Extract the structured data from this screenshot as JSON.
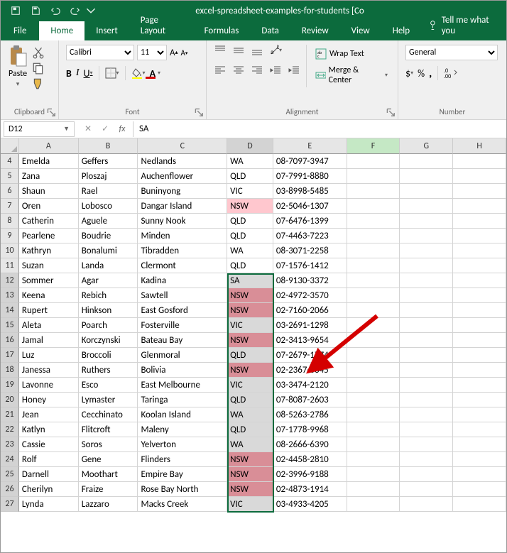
{
  "window": {
    "title": "excel-spreadsheet-examples-for-students  [Co"
  },
  "tabs": {
    "file": "File",
    "home": "Home",
    "insert": "Insert",
    "pagelayout": "Page Layout",
    "formulas": "Formulas",
    "data": "Data",
    "review": "Review",
    "view": "View",
    "help": "Help",
    "tell": "Tell me what you"
  },
  "ribbon": {
    "clipboard": {
      "paste": "Paste",
      "label": "Clipboard"
    },
    "font": {
      "name": "Calibri",
      "size": "11",
      "label": "Font"
    },
    "alignment": {
      "wrap": "Wrap Text",
      "merge": "Merge & Center",
      "label": "Alignment"
    },
    "number": {
      "format": "General",
      "label": "Number"
    }
  },
  "formula_bar": {
    "name": "D12",
    "value": "SA"
  },
  "columns": [
    "A",
    "B",
    "C",
    "D",
    "E",
    "F",
    "G",
    "H"
  ],
  "row_start": 4,
  "rows": [
    {
      "n": 4,
      "a": "Emelda",
      "b": "Geffers",
      "c": "Nedlands",
      "d": "WA",
      "e": "08-7097-3947",
      "cls": ""
    },
    {
      "n": 5,
      "a": "Zana",
      "b": "Ploszaj",
      "c": "Auchenflower",
      "d": "QLD",
      "e": "07-7991-8880",
      "cls": ""
    },
    {
      "n": 6,
      "a": "Shaun",
      "b": "Rael",
      "c": "Buninyong",
      "d": "VIC",
      "e": "03-8998-5485",
      "cls": ""
    },
    {
      "n": 7,
      "a": "Oren",
      "b": "Lobosco",
      "c": "Dangar Island",
      "d": "NSW",
      "e": "02-5046-1307",
      "cls": "d-row7"
    },
    {
      "n": 8,
      "a": "Catherin",
      "b": "Aguele",
      "c": "Sunny Nook",
      "d": "QLD",
      "e": "07-6476-1399",
      "cls": ""
    },
    {
      "n": 9,
      "a": "Pearlene",
      "b": "Boudrie",
      "c": "Minden",
      "d": "QLD",
      "e": "07-4463-7223",
      "cls": ""
    },
    {
      "n": 10,
      "a": "Kathryn",
      "b": "Bonalumi",
      "c": "Tibradden",
      "d": "WA",
      "e": "08-3071-2258",
      "cls": ""
    },
    {
      "n": 11,
      "a": "Suzan",
      "b": "Landa",
      "c": "Clermont",
      "d": "QLD",
      "e": "07-1576-1412",
      "cls": ""
    },
    {
      "n": 12,
      "a": "Sommer",
      "b": "Agar",
      "c": "Kadina",
      "d": "SA",
      "e": "08-9130-3372",
      "cls": "d-gray"
    },
    {
      "n": 13,
      "a": "Keena",
      "b": "Rebich",
      "c": "Sawtell",
      "d": "NSW",
      "e": "02-4972-3570",
      "cls": "d-darkpink"
    },
    {
      "n": 14,
      "a": "Rupert",
      "b": "Hinkson",
      "c": "East Gosford",
      "d": "NSW",
      "e": "02-7160-2066",
      "cls": "d-darkpink"
    },
    {
      "n": 15,
      "a": "Aleta",
      "b": "Poarch",
      "c": "Fosterville",
      "d": "VIC",
      "e": "03-2691-1298",
      "cls": "d-gray"
    },
    {
      "n": 16,
      "a": "Jamal",
      "b": "Korczynski",
      "c": "Bateau Bay",
      "d": "NSW",
      "e": "02-3413-9654",
      "cls": "d-darkpink"
    },
    {
      "n": 17,
      "a": "Luz",
      "b": "Broccoli",
      "c": "Glenmoral",
      "d": "QLD",
      "e": "07-2679-1774",
      "cls": "d-gray"
    },
    {
      "n": 18,
      "a": "Janessa",
      "b": "Ruthers",
      "c": "Bolivia",
      "d": "NSW",
      "e": "02-2367-6845",
      "cls": "d-darkpink"
    },
    {
      "n": 19,
      "a": "Lavonne",
      "b": "Esco",
      "c": "East Melbourne",
      "d": "VIC",
      "e": "03-3474-2120",
      "cls": "d-gray"
    },
    {
      "n": 20,
      "a": "Honey",
      "b": "Lymaster",
      "c": "Taringa",
      "d": "QLD",
      "e": "07-8087-2603",
      "cls": "d-gray"
    },
    {
      "n": 21,
      "a": "Jean",
      "b": "Cecchinato",
      "c": "Koolan Island",
      "d": "WA",
      "e": "08-5263-2786",
      "cls": "d-gray"
    },
    {
      "n": 22,
      "a": "Katlyn",
      "b": "Flitcroft",
      "c": "Maleny",
      "d": "QLD",
      "e": "07-1778-9968",
      "cls": "d-gray"
    },
    {
      "n": 23,
      "a": "Cassie",
      "b": "Soros",
      "c": "Yelverton",
      "d": "WA",
      "e": "08-2666-6390",
      "cls": "d-gray"
    },
    {
      "n": 24,
      "a": "Rolf",
      "b": "Gene",
      "c": "Flinders",
      "d": "NSW",
      "e": "02-4458-2810",
      "cls": "d-darkpink"
    },
    {
      "n": 25,
      "a": "Darnell",
      "b": "Moothart",
      "c": "Empire Bay",
      "d": "NSW",
      "e": "02-3996-9188",
      "cls": "d-darkpink"
    },
    {
      "n": 26,
      "a": "Cherilyn",
      "b": "Fraize",
      "c": "Rose Bay North",
      "d": "NSW",
      "e": "02-4873-1914",
      "cls": "d-darkpink"
    },
    {
      "n": 27,
      "a": "Lynda",
      "b": "Lazzaro",
      "c": "Macks Creek",
      "d": "VIC",
      "e": "03-4933-4205",
      "cls": "d-gray"
    }
  ]
}
